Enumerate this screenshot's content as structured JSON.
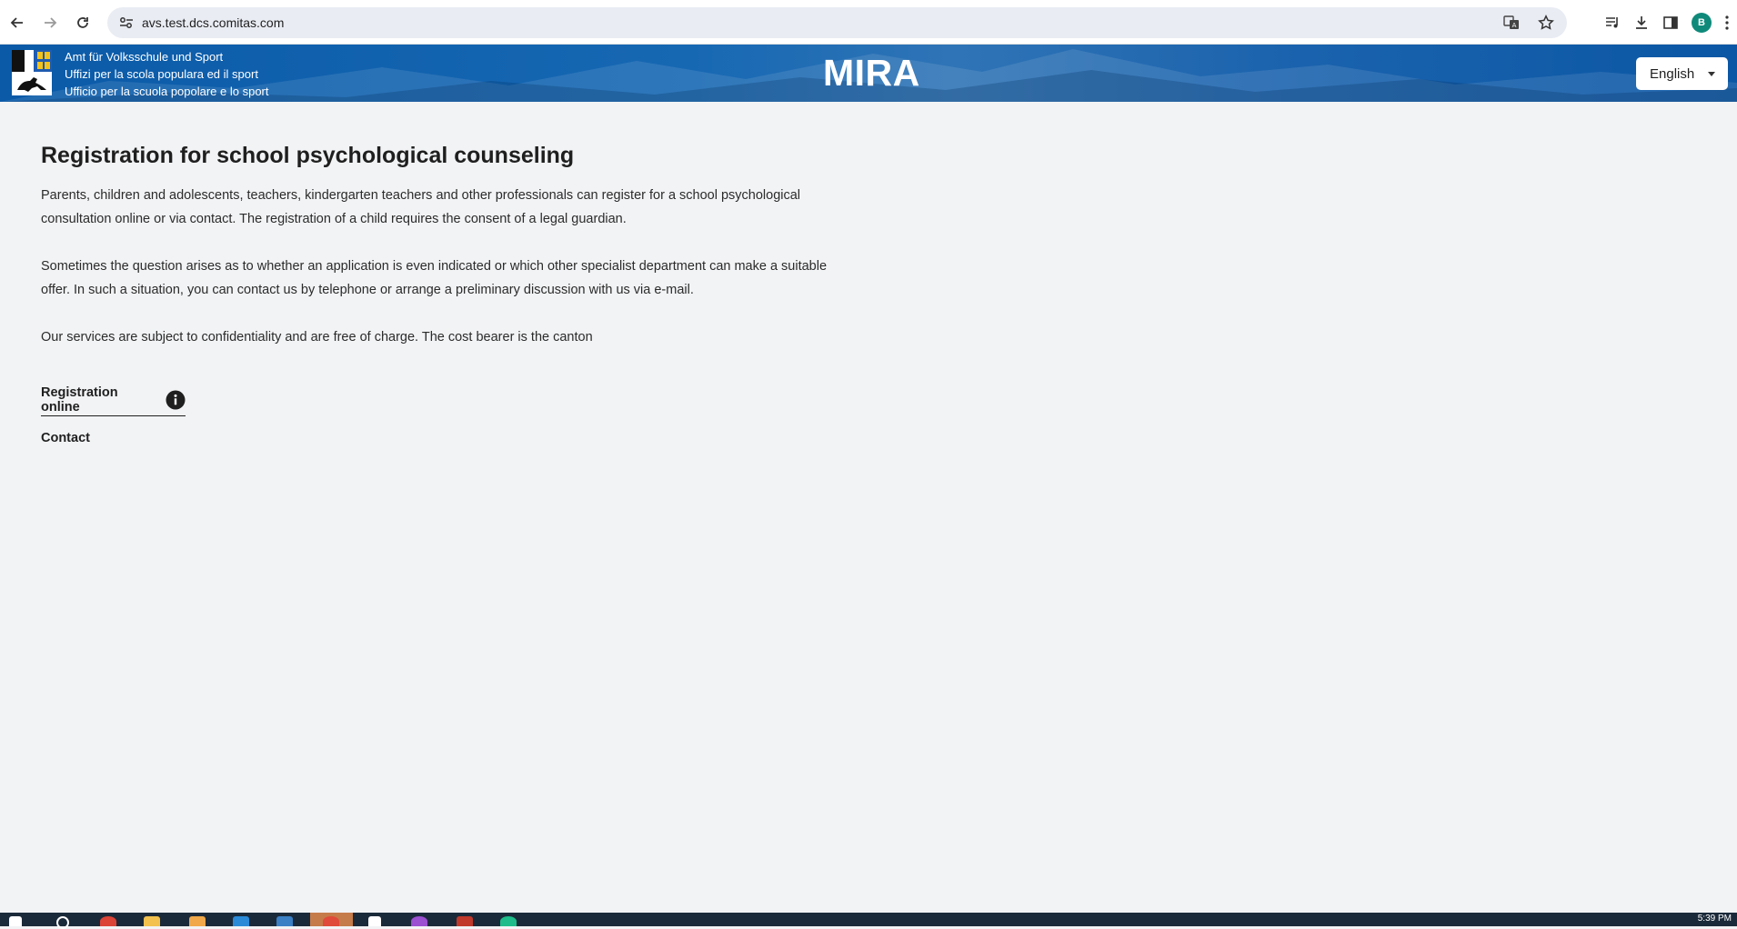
{
  "browser": {
    "url": "avs.test.dcs.comitas.com",
    "profile_initial": "B",
    "icons": [
      "back-icon",
      "forward-icon",
      "reload-icon",
      "site-settings-icon",
      "translate-icon",
      "bookmark-star-icon",
      "media-queue-icon",
      "download-icon",
      "side-panel-icon",
      "kebab-menu-icon"
    ]
  },
  "header": {
    "office_lines": [
      "Amt für Volksschule und Sport",
      "Uffizi per la scola populara ed il sport",
      "Ufficio per la scuola popolare e lo sport"
    ],
    "app_title": "MIRA",
    "language": "English",
    "colors": {
      "brand_blue": "#0a5aa8"
    }
  },
  "main": {
    "title": "Registration for school psychological counseling",
    "paragraphs": [
      "Parents, children and adolescents, teachers, kindergarten teachers and other professionals can register for a school psychological consultation online or via contact. The registration of a child requires the consent of a legal guardian.",
      "Sometimes the question arises as to whether an application is even indicated or which other specialist department can make a suitable offer. In such a situation, you can contact us by telephone or arrange a preliminary discussion with us via e-mail.",
      "Our services are subject to confidentiality and are free of charge. The cost bearer is the canton"
    ],
    "tabs": [
      {
        "label": "Registration online",
        "active": true,
        "icon": "info-icon"
      },
      {
        "label": "Contact",
        "active": false
      }
    ]
  },
  "taskbar": {
    "clock": "5:39 PM"
  }
}
